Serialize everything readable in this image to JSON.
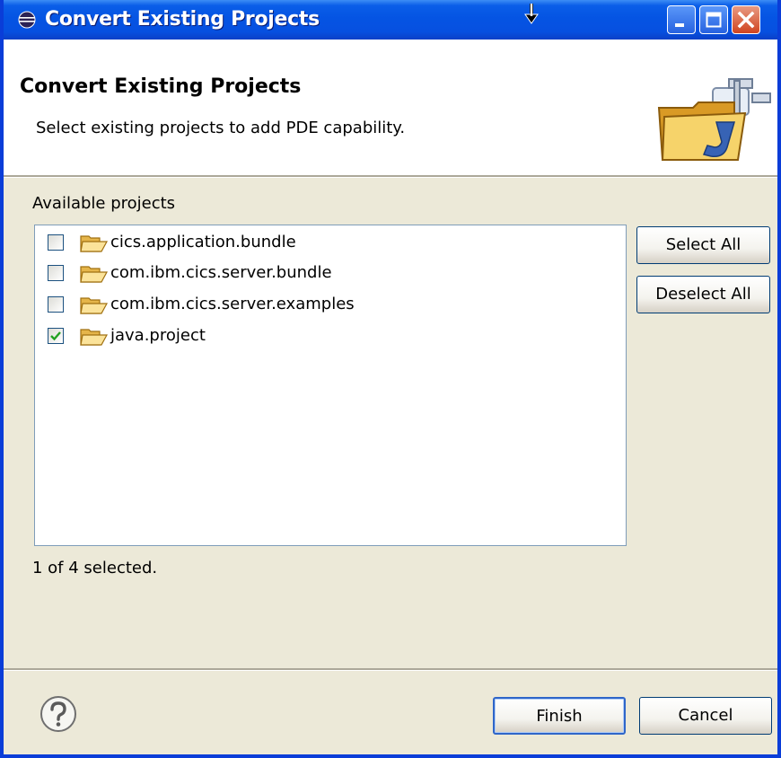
{
  "window": {
    "title": "Convert Existing Projects"
  },
  "header": {
    "title": "Convert Existing Projects",
    "description": "Select existing projects to add PDE capability."
  },
  "projects": {
    "label": "Available projects",
    "items": [
      {
        "label": "cics.application.bundle",
        "checked": false
      },
      {
        "label": "com.ibm.cics.server.bundle",
        "checked": false
      },
      {
        "label": "com.ibm.cics.server.examples",
        "checked": false
      },
      {
        "label": "java.project",
        "checked": true
      }
    ],
    "status": "1 of 4 selected."
  },
  "buttons": {
    "select_all": "Select All",
    "deselect_all": "Deselect All",
    "finish": "Finish",
    "cancel": "Cancel"
  },
  "icons": {
    "window": "eclipse-icon",
    "banner": "java-folder-plugin-icon",
    "item": "folder-open-icon",
    "help": "help-icon"
  },
  "colors": {
    "titlebar": "#0554e3",
    "dialog_bg": "#ece9d8",
    "check": "#21a121"
  }
}
